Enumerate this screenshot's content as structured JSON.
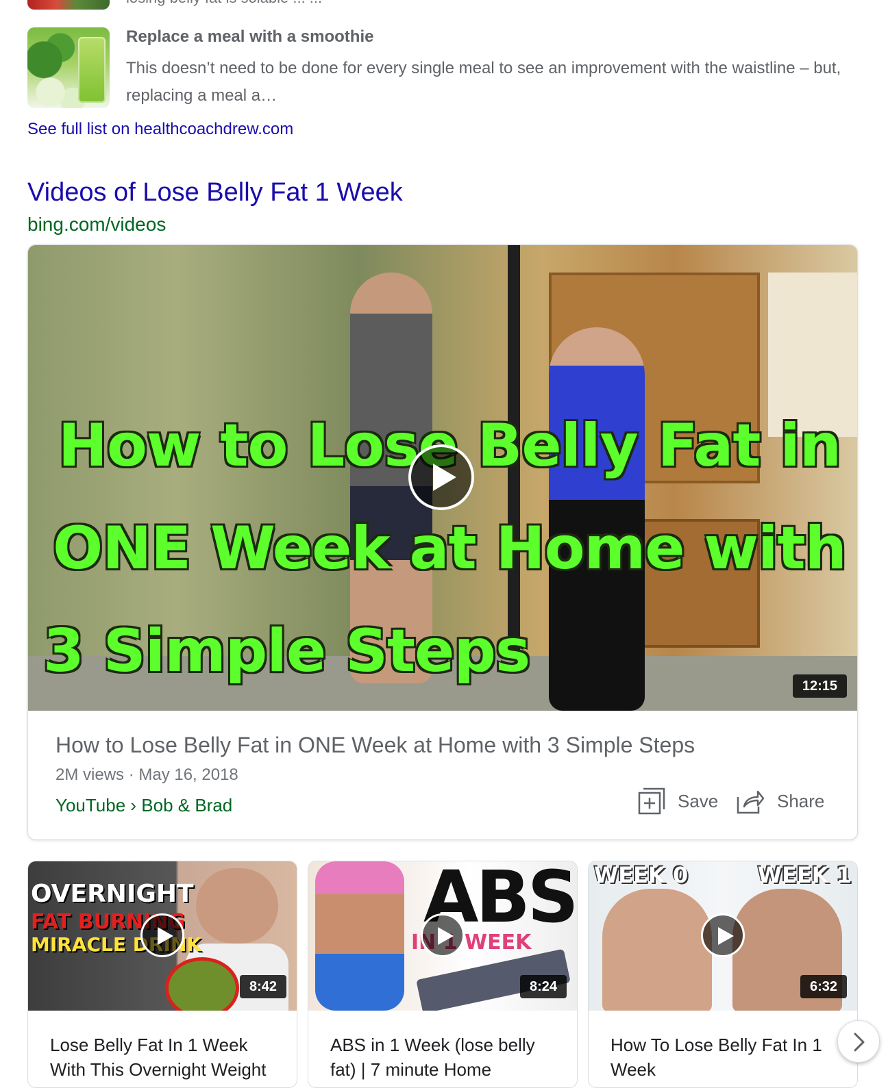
{
  "list": {
    "prev_snippet_cut": "losing belly fat is solable ... ...",
    "item": {
      "title": "Replace a meal with a smoothie",
      "snippet": "This doesn’t need to be done for every single meal to see an improvement with the waistline – but, replacing a meal a…"
    },
    "see_full_list": "See full list on healthcoachdrew.com"
  },
  "videos": {
    "heading": "Videos of Lose Belly Fat 1 Week",
    "source": "bing.com/videos",
    "main": {
      "thumb_overlay_lines": [
        "How to Lose Belly Fat in",
        "ONE Week at Home with",
        "3 Simple Steps"
      ],
      "duration": "12:15",
      "title": "How to Lose Belly Fat in ONE Week at Home with 3 Simple Steps",
      "meta": "2M views · May 16, 2018",
      "channel": "YouTube › Bob & Brad",
      "save_label": "Save",
      "share_label": "Share"
    },
    "cards": [
      {
        "thumb_text": [
          "OVERNIGHT",
          "FAT BURNING",
          "MIRACLE DRINK"
        ],
        "duration": "8:42",
        "title": "Lose Belly Fat In 1 Week With This Overnight Weight"
      },
      {
        "thumb_text": [
          "ABS",
          "IN 1 WEEK"
        ],
        "duration": "8:24",
        "title": "ABS in 1 Week (lose belly fat) | 7 minute Home"
      },
      {
        "thumb_text": [
          "WEEK 0",
          "WEEK 1"
        ],
        "duration": "6:32",
        "title": "How To Lose Belly Fat In 1 Week"
      }
    ],
    "icons": {
      "play": "play-icon",
      "save": "save-icon",
      "share": "share-icon",
      "next": "chevron-right-icon"
    }
  }
}
